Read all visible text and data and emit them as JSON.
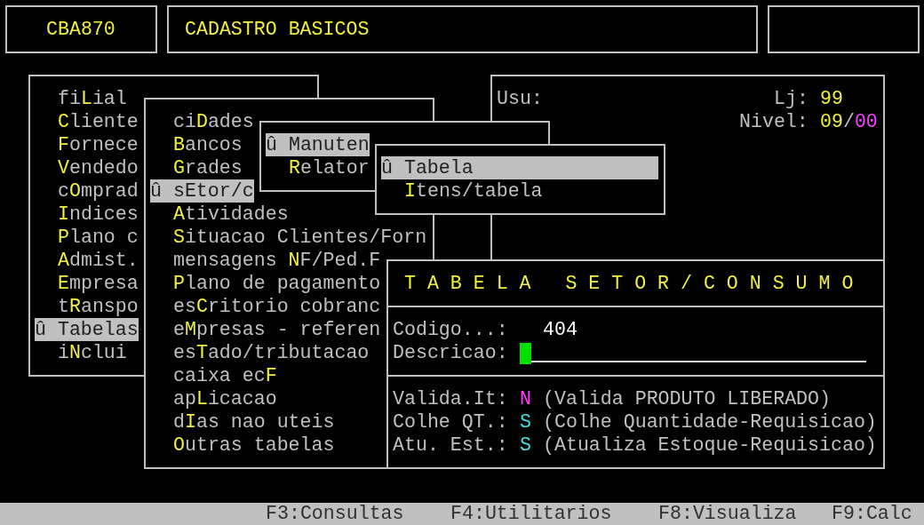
{
  "header": {
    "program_code": "CBA870",
    "title": "CADASTRO BASICOS"
  },
  "session": {
    "user_label": "Usu:",
    "store_label": "Lj:",
    "store_value": "99",
    "nivel_label": "Nivel:",
    "nivel_value_1": "09",
    "nivel_separator": "/",
    "nivel_value_2": "00"
  },
  "menus": [
    {
      "items": [
        {
          "pre": "fi",
          "key": "L",
          "post": "ial",
          "selected": false
        },
        {
          "key": "C",
          "post": "liente",
          "selected": false
        },
        {
          "key": "F",
          "post": "ornece",
          "selected": false
        },
        {
          "key": "V",
          "post": "endedo",
          "selected": false
        },
        {
          "pre": "c",
          "key": "O",
          "post": "mprad",
          "selected": false
        },
        {
          "key": "I",
          "post": "ndices",
          "selected": false
        },
        {
          "key": "P",
          "post": "lano c",
          "selected": false
        },
        {
          "key": "A",
          "post": "dmist.",
          "selected": false
        },
        {
          "key": "E",
          "post": "mpresa",
          "selected": false
        },
        {
          "pre": "t",
          "key": "R",
          "post": "anspo",
          "selected": false
        },
        {
          "pre": "û Tabelas",
          "selected": true
        },
        {
          "pre": "i",
          "key": "N",
          "post": "clui",
          "selected": false
        }
      ]
    },
    {
      "items": [
        {
          "pre": "ci",
          "key": "D",
          "post": "ades",
          "selected": false
        },
        {
          "key": "B",
          "post": "ancos",
          "selected": false
        },
        {
          "key": "G",
          "post": "rades",
          "selected": false
        },
        {
          "pre": "û sEtor/c",
          "selected": true
        },
        {
          "key": "A",
          "post": "tividades",
          "selected": false
        },
        {
          "key": "S",
          "post": "ituacao Clientes/Forn",
          "selected": false
        },
        {
          "pre": "mensagens ",
          "key": "N",
          "post": "F/Ped.F",
          "selected": false
        },
        {
          "key": "P",
          "post": "lano de pagamento",
          "selected": false
        },
        {
          "pre": "es",
          "key": "C",
          "post": "ritorio cobranc",
          "selected": false
        },
        {
          "pre": "e",
          "key": "M",
          "post": "presas - referen",
          "selected": false
        },
        {
          "pre": "es",
          "key": "T",
          "post": "ado/tributacao",
          "selected": false
        },
        {
          "pre": "caixa ec",
          "key": "F",
          "selected": false
        },
        {
          "pre": "ap",
          "key": "L",
          "post": "icacao",
          "selected": false
        },
        {
          "pre": "d",
          "key": "I",
          "post": "as nao uteis",
          "selected": false
        },
        {
          "key": "O",
          "post": "utras tabelas",
          "selected": false
        }
      ]
    },
    {
      "items": [
        {
          "pre": "û Manuten",
          "selected": true
        },
        {
          "key": "R",
          "post": "elator",
          "selected": false
        }
      ]
    },
    {
      "items": [
        {
          "pre": "û Tabela",
          "selected": true
        },
        {
          "key": "I",
          "post": "tens/tabela",
          "selected": false
        }
      ]
    }
  ],
  "form": {
    "title": "T A B E L A   S E T O R / C O N S U M O",
    "codigo_label": "Codigo...:",
    "codigo_value": "404",
    "descricao_label": "Descricao:",
    "options": [
      {
        "label": "Valida.It:",
        "value": "N",
        "color": "#ff40ff",
        "description": "(Valida PRODUTO LIBERADO)"
      },
      {
        "label": "Colhe QT.:",
        "value": "S",
        "color": "#40e0e0",
        "description": "(Colhe Quantidade-Requisicao)"
      },
      {
        "label": "Atu. Est.:",
        "value": "S",
        "color": "#40e0e0",
        "description": "(Atualiza Estoque-Requisicao)"
      }
    ]
  },
  "status_bar": [
    "F3:Consultas",
    "F4:Utilitarios",
    "F8:Visualiza",
    "F9:Calc"
  ]
}
